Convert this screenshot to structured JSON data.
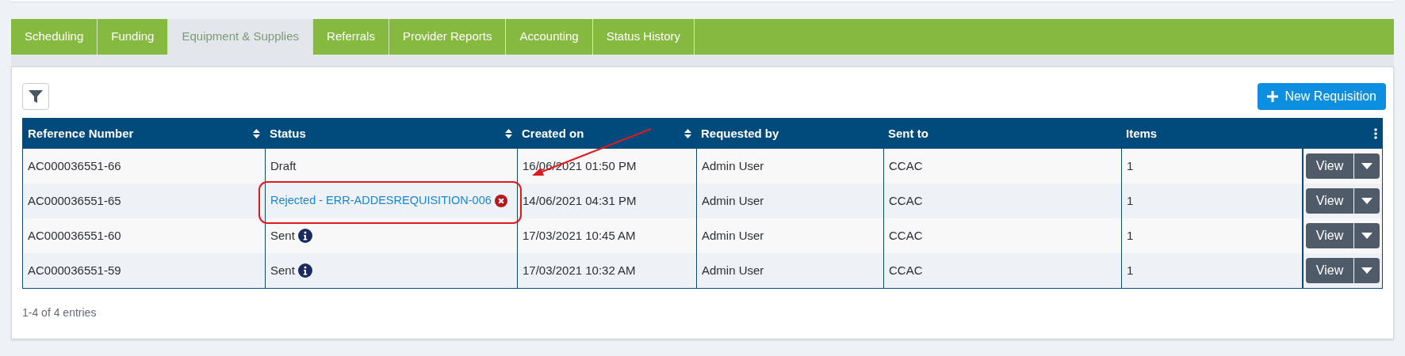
{
  "tabs": [
    {
      "label": "Scheduling",
      "selected": false
    },
    {
      "label": "Funding",
      "selected": false
    },
    {
      "label": "Equipment & Supplies",
      "selected": true
    },
    {
      "label": "Referrals",
      "selected": false
    },
    {
      "label": "Provider Reports",
      "selected": false
    },
    {
      "label": "Accounting",
      "selected": false
    },
    {
      "label": "Status History",
      "selected": false
    }
  ],
  "new_button": {
    "label": "New Requisition"
  },
  "table": {
    "columns": [
      {
        "label": "Reference Number",
        "sortable": true
      },
      {
        "label": "Status",
        "sortable": true
      },
      {
        "label": "Created on",
        "sortable": true
      },
      {
        "label": "Requested by",
        "sortable": false
      },
      {
        "label": "Sent to",
        "sortable": false
      },
      {
        "label": "Items",
        "sortable": false
      }
    ],
    "rows": [
      {
        "reference": "AC000036551-66",
        "status": {
          "kind": "plain",
          "text": "Draft"
        },
        "created": "16/06/2021 01:50 PM",
        "requested_by": "Admin User",
        "sent_to": "CCAC",
        "items": "1",
        "action": "View"
      },
      {
        "reference": "AC000036551-65",
        "status": {
          "kind": "rejected",
          "text": "Rejected - ERR-ADDESREQUISITION-006"
        },
        "created": "14/06/2021 04:31 PM",
        "requested_by": "Admin User",
        "sent_to": "CCAC",
        "items": "1",
        "action": "View"
      },
      {
        "reference": "AC000036551-60",
        "status": {
          "kind": "sent",
          "text": "Sent"
        },
        "created": "17/03/2021 10:45 AM",
        "requested_by": "Admin User",
        "sent_to": "CCAC",
        "items": "1",
        "action": "View"
      },
      {
        "reference": "AC000036551-59",
        "status": {
          "kind": "sent",
          "text": "Sent"
        },
        "created": "17/03/2021 10:32 AM",
        "requested_by": "Admin User",
        "sent_to": "CCAC",
        "items": "1",
        "action": "View"
      }
    ]
  },
  "footer": "1-4 of 4 entries"
}
